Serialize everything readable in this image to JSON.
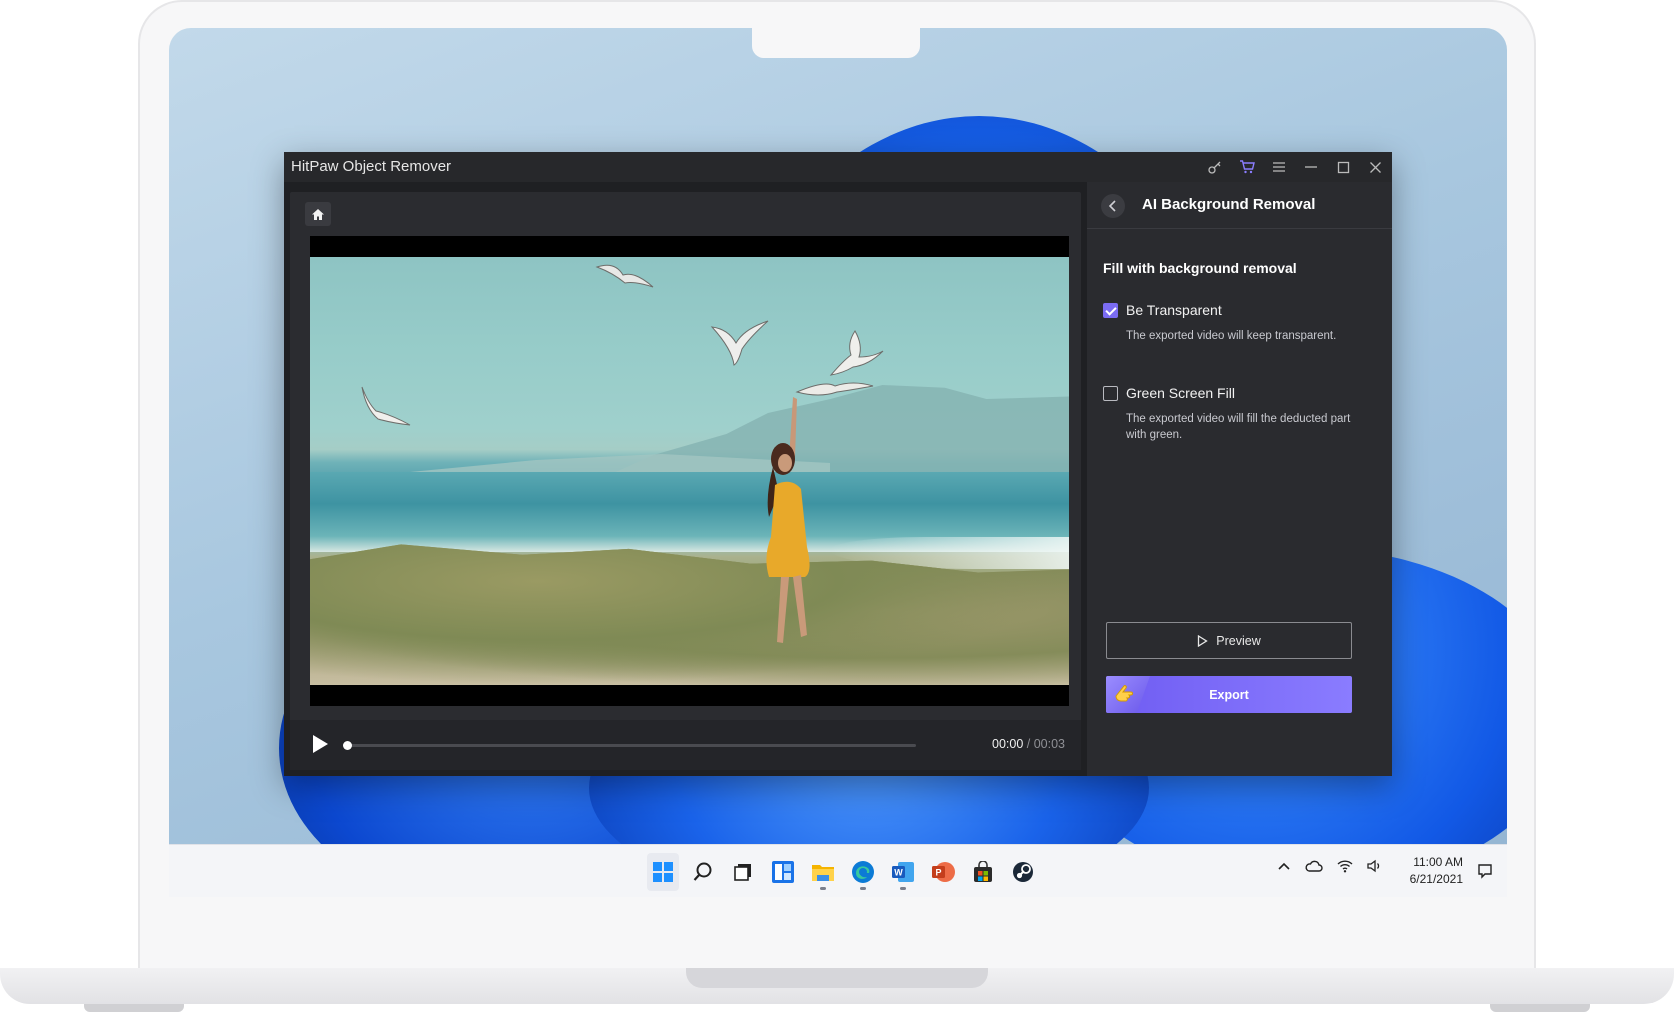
{
  "app": {
    "title": "HitPaw Object Remover"
  },
  "panel": {
    "title": "AI Background Removal",
    "section_title": "Fill with background removal",
    "options": [
      {
        "label": "Be Transparent",
        "description": "The exported video will keep transparent.",
        "checked": true
      },
      {
        "label": "Green Screen Fill",
        "description": "The exported video will fill the deducted part with green.",
        "checked": false
      }
    ],
    "preview_label": "Preview",
    "export_label": "Export"
  },
  "player": {
    "current_time": "00:00",
    "separator": " / ",
    "duration": "00:03",
    "progress": 0.0
  },
  "taskbar": {
    "time": "11:00 AM",
    "date": "6/21/2021"
  },
  "colors": {
    "accent": "#7b6cf3",
    "app_bg": "#1f2023",
    "panel_bg": "#2a2b2f"
  },
  "icons": {
    "titlebar": [
      "key-icon",
      "cart-icon",
      "menu-icon",
      "minimize-icon",
      "maximize-icon",
      "close-icon"
    ],
    "taskbar": [
      "windows-start-icon",
      "search-icon",
      "task-view-icon",
      "widgets-icon",
      "file-explorer-icon",
      "edge-icon",
      "word-icon",
      "powerpoint-icon",
      "store-icon",
      "steam-icon"
    ],
    "tray": [
      "chevron-up-icon",
      "cloud-icon",
      "wifi-icon",
      "volume-icon",
      "notification-icon"
    ]
  }
}
